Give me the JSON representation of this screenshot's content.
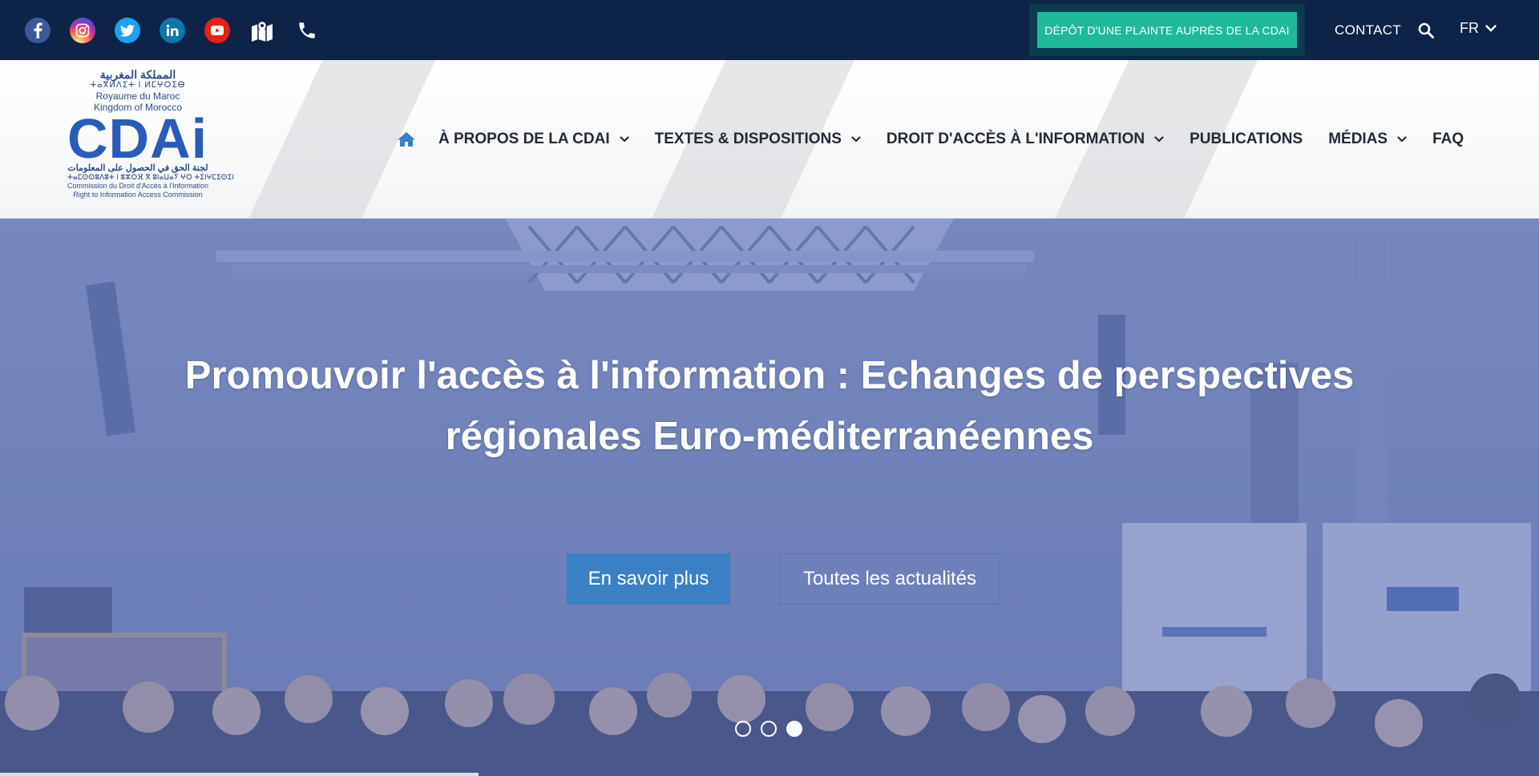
{
  "topbar": {
    "social_icons": [
      "facebook-icon",
      "instagram-icon",
      "twitter-icon",
      "linkedin-icon",
      "youtube-icon",
      "map-icon",
      "phone-icon"
    ],
    "complaint_button": "DÉPÔT D'UNE PLAINTE AUPRÈS DE LA CDAI",
    "contact": "CONTACT",
    "language": "FR"
  },
  "logo": {
    "arabic_country": "المملكة المغربية",
    "tifinagh_country": "ⵜⴰⴳⵍⴷⵉⵜ ⵏ ⵍⵎⵖⵔⵉⴱ",
    "french_country": "Royaume du Maroc",
    "english_country": "Kingdom of Morocco",
    "acronym": "CDAi",
    "arabic_name": "لجنة الحق في الحصول على المعلومات",
    "tifinagh_name": "ⵜⴰⵎⵙⵙⵓⴷⵓⵜ ⵏ ⵓⵣⵔⴼ ⴳ ⵓⵏⴰⵡⴰⵢ ⵖⵔ ⵜⵉⵏⵖⵎⵉⵙⵉⵏ",
    "french_name": "Commission du Droit d'Accès à l'Information",
    "english_name": "Right to Information Access Commission"
  },
  "nav": {
    "items": [
      {
        "label": "À PROPOS DE LA CDAI",
        "has_dropdown": true
      },
      {
        "label": "TEXTES & DISPOSITIONS",
        "has_dropdown": true
      },
      {
        "label": "DROIT D'ACCÈS À L'INFORMATION",
        "has_dropdown": true
      },
      {
        "label": "PUBLICATIONS",
        "has_dropdown": false
      },
      {
        "label": "MÉDIAS",
        "has_dropdown": true
      },
      {
        "label": "FAQ",
        "has_dropdown": false
      }
    ]
  },
  "hero": {
    "title_line1": "Promouvoir l'accès à l'information : Echanges de perspectives",
    "title_line2": "régionales Euro-méditerranéennes",
    "primary_button": "En savoir plus",
    "secondary_button": "Toutes les actualités",
    "slides_count": 3,
    "active_slide": 3
  },
  "colors": {
    "topbar_bg": "#0d2348",
    "complaint_green": "#1fb89b",
    "primary_blue": "#3b7fc4",
    "hero_tint": "#6f7fb6"
  }
}
